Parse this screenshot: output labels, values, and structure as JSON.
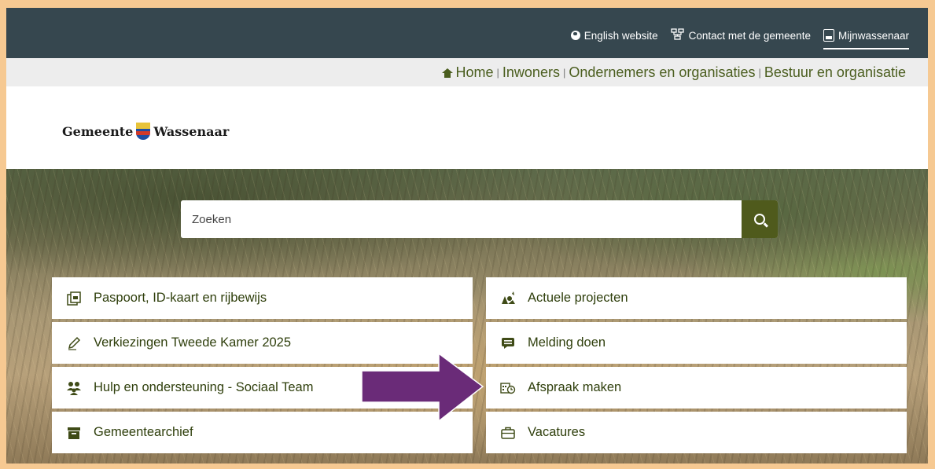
{
  "topbar": {
    "links": [
      {
        "label": "English website",
        "icon": "globe-icon"
      },
      {
        "label": "Contact met de gemeente",
        "icon": "network-icon"
      },
      {
        "label": "Mijnwassenaar",
        "icon": "mijnwassenaar-icon"
      }
    ]
  },
  "nav": {
    "items": [
      "Home",
      "Inwoners",
      "Ondernemers en organisaties",
      "Bestuur en organisatie"
    ],
    "separator": "|"
  },
  "logo": {
    "left": "Gemeente",
    "right": "Wassenaar"
  },
  "search": {
    "placeholder": "Zoeken"
  },
  "tiles_left": [
    {
      "label": "Paspoort, ID-kaart en rijbewijs",
      "icon": "id-card-icon"
    },
    {
      "label": "Verkiezingen Tweede Kamer 2025",
      "icon": "pencil-icon"
    },
    {
      "label": "Hulp en ondersteuning - Sociaal Team",
      "icon": "people-icon"
    },
    {
      "label": "Gemeentearchief",
      "icon": "archive-icon"
    }
  ],
  "tiles_right": [
    {
      "label": "Actuele projecten",
      "icon": "projects-icon"
    },
    {
      "label": "Melding doen",
      "icon": "message-icon"
    },
    {
      "label": "Afspraak maken",
      "icon": "calendar-clock-icon"
    },
    {
      "label": "Vacatures",
      "icon": "briefcase-icon"
    }
  ],
  "colors": {
    "accent": "#4f5a1c",
    "topbar": "#36474f",
    "arrow": "#6a2b78",
    "border": "#f6c992"
  }
}
